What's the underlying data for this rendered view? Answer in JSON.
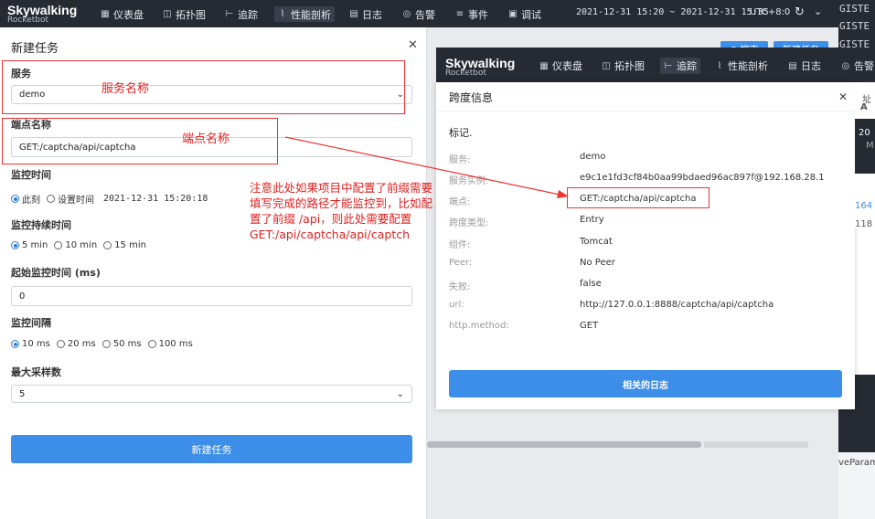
{
  "app": {
    "logo": "Skywalking",
    "subtitle": "Rocketbot"
  },
  "nav": {
    "items": [
      {
        "label": "仪表盘"
      },
      {
        "label": "拓扑图"
      },
      {
        "label": "追踪"
      },
      {
        "label": "性能剖析"
      },
      {
        "label": "日志"
      },
      {
        "label": "告警"
      },
      {
        "label": "事件"
      },
      {
        "label": "调试"
      }
    ],
    "time_range": "2021-12-31 15:20 ~ 2021-12-31 15:35",
    "timezone": "UTC+8:0"
  },
  "right_strip": {
    "lines": [
      "GISTE",
      "GISTE",
      "GISTE"
    ],
    "bottom_text": "veParam"
  },
  "new_task": {
    "title": "新建任务",
    "service_label": "服务",
    "service_value": "demo",
    "endpoint_label": "端点名称",
    "endpoint_value": "GET:/captcha/api/captcha",
    "monitor_time_label": "监控时间",
    "monitor_time_options": [
      "此刻",
      "设置时间"
    ],
    "monitor_time_value": "2021-12-31 15:20:18",
    "duration_label": "监控持续时间",
    "duration_options": [
      "5 min",
      "10 min",
      "15 min"
    ],
    "min_duration_label": "起始监控时间 (ms)",
    "min_duration_value": "0",
    "interval_label": "监控间隔",
    "interval_options": [
      "10 ms",
      "20 ms",
      "50 ms",
      "100 ms"
    ],
    "max_sampling_label": "最大采样数",
    "max_sampling_value": "5",
    "submit_label": "新建任务"
  },
  "annotations": {
    "service_name": "服务名称",
    "endpoint_name": "端点名称",
    "note": "注意此处如果项目中配置了前缀需要填写完成的路径才能监控到，比如配置了前缀 /api，则此处需要配置GET:/api/captcha/api/captch"
  },
  "bg_buttons": {
    "search": "Q 搜索",
    "new_task": "新建任务"
  },
  "span_dialog": {
    "title": "跨度信息",
    "tag_header": "标记.",
    "rows": [
      {
        "key": "服务:",
        "value": "demo"
      },
      {
        "key": "服务实例:",
        "value": "e9c1e1fd3cf84b0aa99bdaed96ac897f@192.168.28.1"
      },
      {
        "key": "端点:",
        "value": "GET:/captcha/api/captcha"
      },
      {
        "key": "跨度类型:",
        "value": "Entry"
      },
      {
        "key": "组件:",
        "value": "Tomcat"
      },
      {
        "key": "Peer:",
        "value": "No Peer"
      },
      {
        "key": "失败:",
        "value": "false"
      },
      {
        "key": "url:",
        "value": "http://127.0.0.1:8888/captcha/api/captcha"
      },
      {
        "key": "http.method:",
        "value": "GET"
      }
    ],
    "logs_button": "相关的日志",
    "bg_nav_items": [
      "仪表盘",
      "拓扑图",
      "追踪",
      "性能剖析",
      "日志",
      "告警"
    ],
    "side_fragments": [
      "址",
      "A",
      "20",
      "M",
      "164",
      "118"
    ]
  },
  "colors": {
    "primary": "#3d8ee8",
    "nav_bg": "#252a33",
    "annotation": "#e02020"
  }
}
